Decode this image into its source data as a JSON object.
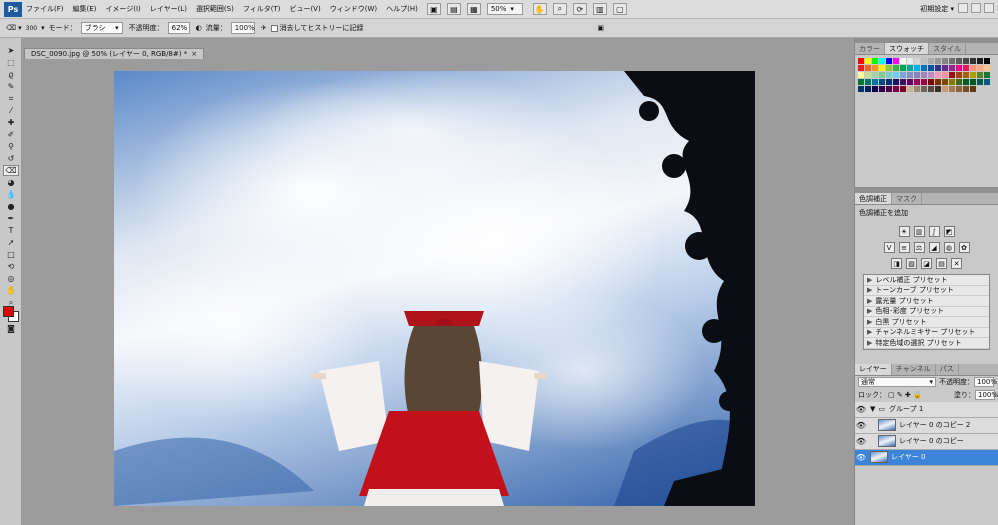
{
  "menubar": {
    "app_icon": "Ps",
    "items": [
      "ファイル(F)",
      "編集(E)",
      "イメージ(I)",
      "レイヤー(L)",
      "選択範囲(S)",
      "フィルタ(T)",
      "ビュー(V)",
      "ウィンドウ(W)",
      "ヘルプ(H)"
    ],
    "zoom": "50%",
    "workspace": "初期設定 ▾"
  },
  "options": {
    "brush_size": "300",
    "mode_label": "モード：",
    "mode_value": "ブラシ",
    "opacity_label": "不透明度：",
    "opacity_value": "62%",
    "flow_label": "流量：",
    "flow_value": "100%",
    "history_label": "消去してヒストリーに記録"
  },
  "document": {
    "tab_title": "DSC_0090.jpg @ 50% (レイヤー 0, RGB/8#) *"
  },
  "swatches_panel": {
    "tabs": [
      "カラー",
      "スウォッチ",
      "スタイル"
    ],
    "active_tab": 1,
    "colors": [
      "#ff0000",
      "#ffff00",
      "#00ff00",
      "#00ffff",
      "#0000ff",
      "#ff00ff",
      "#ffffff",
      "#ebebeb",
      "#d6d6d6",
      "#c2c2c2",
      "#adadad",
      "#999999",
      "#858585",
      "#707070",
      "#5c5c5c",
      "#474747",
      "#333333",
      "#1f1f1f",
      "#000000",
      "#ed1c24",
      "#f26522",
      "#f7941d",
      "#fff200",
      "#8dc63f",
      "#39b54a",
      "#00a651",
      "#00a99d",
      "#00aeef",
      "#0072bc",
      "#0054a6",
      "#2e3192",
      "#662d91",
      "#92278f",
      "#ec008c",
      "#ed145b",
      "#f69679",
      "#f9ad81",
      "#fdc68a",
      "#fff799",
      "#c4df9b",
      "#a3d39c",
      "#82ca9c",
      "#7accc8",
      "#6dcff6",
      "#7da7d9",
      "#8393ca",
      "#8781bd",
      "#a186be",
      "#bd8cbf",
      "#f49ac1",
      "#f5989d",
      "#9e0b0f",
      "#a0410d",
      "#a36209",
      "#aba000",
      "#598527",
      "#1a7b30",
      "#007236",
      "#00746b",
      "#0076a3",
      "#004b80",
      "#003471",
      "#1b1464",
      "#440e62",
      "#630460",
      "#9e005d",
      "#9e0039",
      "#790000",
      "#7b2e00",
      "#7d4900",
      "#827b00",
      "#406618",
      "#005e20",
      "#005826",
      "#005952",
      "#005b7f",
      "#003663",
      "#002157",
      "#0d004c",
      "#32004b",
      "#4b0049",
      "#7b0046",
      "#7a0026",
      "#c7b299",
      "#998675",
      "#736357",
      "#534741",
      "#37302a",
      "#c69c6d",
      "#a67c52",
      "#8c6239",
      "#754c24",
      "#603913"
    ]
  },
  "adjust_panel": {
    "tabs": [
      "色調補正",
      "マスク"
    ],
    "active_tab": 0,
    "title": "色調補正を追加",
    "presets": [
      "レベル補正 プリセット",
      "トーンカーブ プリセット",
      "露光量 プリセット",
      "色相･彩度 プリセット",
      "白黒 プリセット",
      "チャンネルミキサー プリセット",
      "特定色域の選択 プリセット"
    ]
  },
  "layers_panel": {
    "tabs": [
      "レイヤー",
      "チャンネル",
      "パス"
    ],
    "active_tab": 0,
    "blend_mode": "通常",
    "opacity_label": "不透明度：",
    "opacity_value": "100%",
    "lock_label": "ロック：",
    "fill_label": "塗り：",
    "fill_value": "100%",
    "group_name": "グループ 1",
    "layers": [
      "レイヤー 0 のコピー 2",
      "レイヤー 0 のコピー",
      "レイヤー 0"
    ],
    "selected_index": 2
  }
}
